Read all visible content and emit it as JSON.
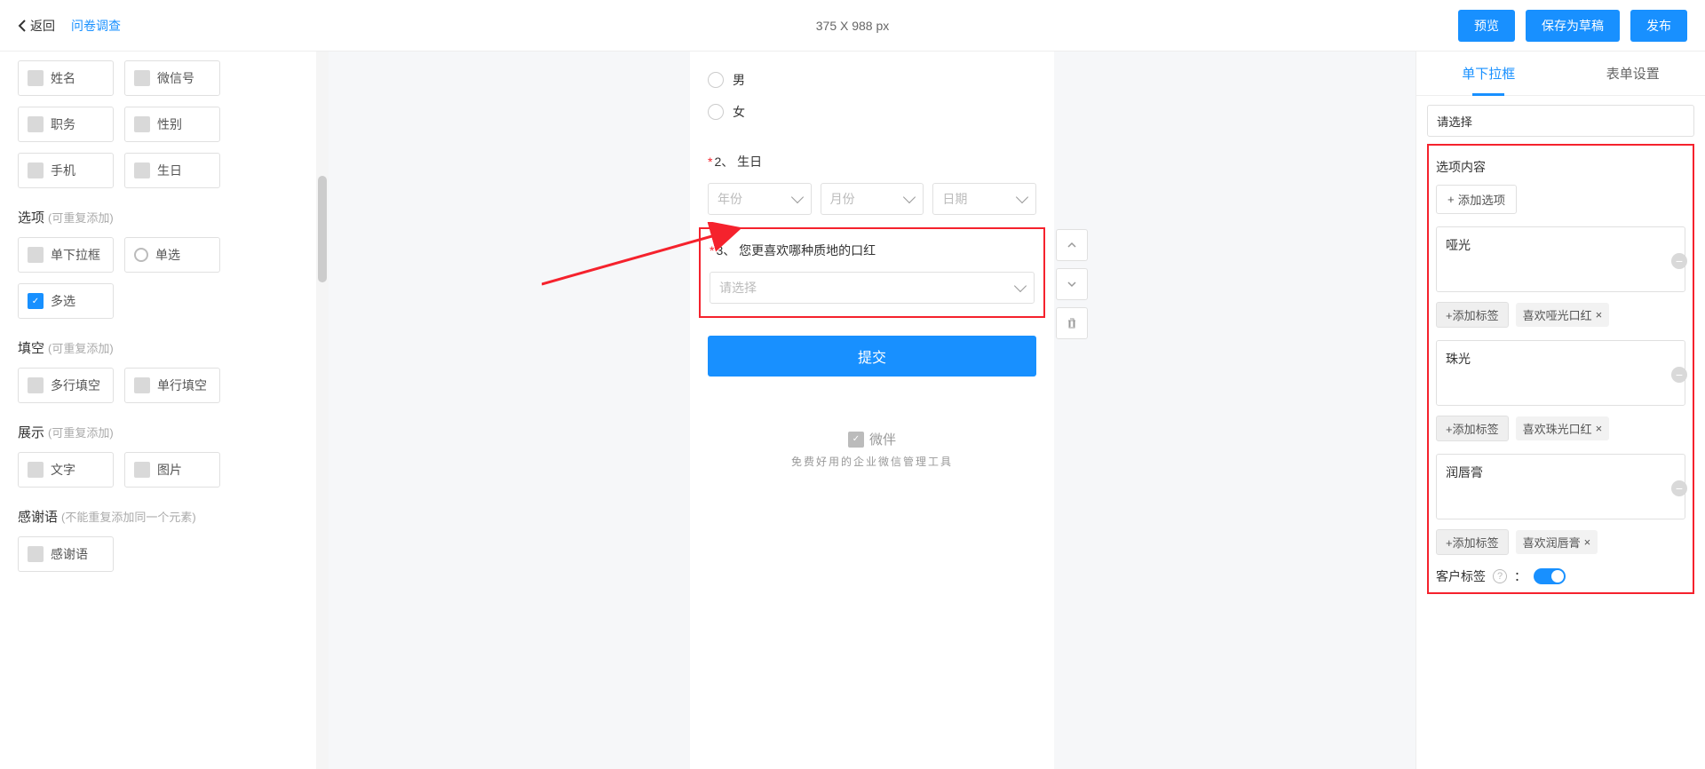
{
  "header": {
    "back": "返回",
    "crumb": "问卷调查",
    "dims": "375 X 988 px",
    "preview": "预览",
    "draft": "保存为草稿",
    "publish": "发布"
  },
  "left": {
    "basic": [
      {
        "icon": "name",
        "label": "姓名"
      },
      {
        "icon": "wechat",
        "label": "微信号"
      },
      {
        "icon": "job",
        "label": "职务"
      },
      {
        "icon": "gender",
        "label": "性别"
      },
      {
        "icon": "phone",
        "label": "手机"
      },
      {
        "icon": "bday",
        "label": "生日"
      }
    ],
    "sect_option": {
      "title": "选项",
      "hint": "(可重复添加)"
    },
    "option": [
      {
        "icon": "dd",
        "label": "单下拉框"
      },
      {
        "icon": "radio",
        "label": "单选"
      },
      {
        "icon": "check",
        "label": "多选",
        "blue": true
      }
    ],
    "sect_fill": {
      "title": "填空",
      "hint": "(可重复添加)"
    },
    "fill": [
      {
        "icon": "multi",
        "label": "多行填空"
      },
      {
        "icon": "single",
        "label": "单行填空"
      }
    ],
    "sect_show": {
      "title": "展示",
      "hint": "(可重复添加)"
    },
    "show": [
      {
        "icon": "text",
        "label": "文字"
      },
      {
        "icon": "img",
        "label": "图片"
      }
    ],
    "sect_thanks": {
      "title": "感谢语",
      "hint": "(不能重复添加同一个元素)"
    },
    "thanks": [
      {
        "icon": "ty",
        "label": "感谢语"
      }
    ]
  },
  "preview": {
    "q1": {
      "opts": [
        "男",
        "女"
      ]
    },
    "q2": {
      "title": "2、 生日",
      "selects": [
        "年份",
        "月份",
        "日期"
      ]
    },
    "q3": {
      "title": "3、 您更喜欢哪种质地的口红",
      "placeholder": "请选择"
    },
    "submit": "提交",
    "brand": "微伴",
    "brand_sub": "免费好用的企业微信管理工具"
  },
  "right": {
    "tab1": "单下拉框",
    "tab2": "表单设置",
    "placeholder_value": "请选择",
    "section_title": "选项内容",
    "add_option": "添加选项",
    "options": [
      {
        "text": "哑光",
        "tag": "喜欢哑光口红"
      },
      {
        "text": "珠光",
        "tag": "喜欢珠光口红"
      },
      {
        "text": "润唇膏",
        "tag": "喜欢润唇膏"
      }
    ],
    "add_tag": "+添加标签",
    "customer_tag": "客户标签"
  }
}
